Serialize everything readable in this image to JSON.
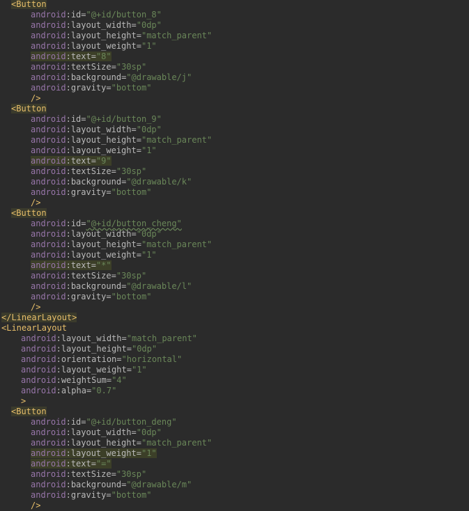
{
  "code_lines": [
    {
      "kind": "tag",
      "indent": 2,
      "text": "<Button",
      "highlight": true
    },
    {
      "kind": "attr",
      "indent": 6,
      "ns": "android",
      "attr": "id",
      "value": "\"@+id/button_8\""
    },
    {
      "kind": "attr",
      "indent": 6,
      "ns": "android",
      "attr": "layout_width",
      "value": "\"0dp\""
    },
    {
      "kind": "attr",
      "indent": 6,
      "ns": "android",
      "attr": "layout_height",
      "value": "\"match_parent\""
    },
    {
      "kind": "attr",
      "indent": 6,
      "ns": "android",
      "attr": "layout_weight",
      "value": "\"1\""
    },
    {
      "kind": "attr",
      "indent": 6,
      "ns": "android",
      "attr": "text",
      "value": "\"8\"",
      "highlight": true
    },
    {
      "kind": "attr",
      "indent": 6,
      "ns": "android",
      "attr": "textSize",
      "value": "\"30sp\""
    },
    {
      "kind": "attr",
      "indent": 6,
      "ns": "android",
      "attr": "background",
      "value": "\"@drawable/j\""
    },
    {
      "kind": "attr",
      "indent": 6,
      "ns": "android",
      "attr": "gravity",
      "value": "\"bottom\""
    },
    {
      "kind": "tag",
      "indent": 6,
      "text": "/>"
    },
    {
      "kind": "tag",
      "indent": 2,
      "text": "<Button",
      "highlight": true
    },
    {
      "kind": "attr",
      "indent": 6,
      "ns": "android",
      "attr": "id",
      "value": "\"@+id/button_9\""
    },
    {
      "kind": "attr",
      "indent": 6,
      "ns": "android",
      "attr": "layout_width",
      "value": "\"0dp\""
    },
    {
      "kind": "attr",
      "indent": 6,
      "ns": "android",
      "attr": "layout_height",
      "value": "\"match_parent\""
    },
    {
      "kind": "attr",
      "indent": 6,
      "ns": "android",
      "attr": "layout_weight",
      "value": "\"1\""
    },
    {
      "kind": "attr",
      "indent": 6,
      "ns": "android",
      "attr": "text",
      "value": "\"9\"",
      "highlight": true
    },
    {
      "kind": "attr",
      "indent": 6,
      "ns": "android",
      "attr": "textSize",
      "value": "\"30sp\""
    },
    {
      "kind": "attr",
      "indent": 6,
      "ns": "android",
      "attr": "background",
      "value": "\"@drawable/k\""
    },
    {
      "kind": "attr",
      "indent": 6,
      "ns": "android",
      "attr": "gravity",
      "value": "\"bottom\""
    },
    {
      "kind": "tag",
      "indent": 6,
      "text": "/>"
    },
    {
      "kind": "tag",
      "indent": 2,
      "text": "<Button",
      "highlight": true
    },
    {
      "kind": "attr",
      "indent": 6,
      "ns": "android",
      "attr": "id",
      "value": "\"@+id/button_cheng\"",
      "squiggle": true
    },
    {
      "kind": "attr",
      "indent": 6,
      "ns": "android",
      "attr": "layout_width",
      "value": "\"0dp\""
    },
    {
      "kind": "attr",
      "indent": 6,
      "ns": "android",
      "attr": "layout_height",
      "value": "\"match_parent\""
    },
    {
      "kind": "attr",
      "indent": 6,
      "ns": "android",
      "attr": "layout_weight",
      "value": "\"1\""
    },
    {
      "kind": "attr",
      "indent": 6,
      "ns": "android",
      "attr": "text",
      "value": "\"*\"",
      "highlight": true
    },
    {
      "kind": "attr",
      "indent": 6,
      "ns": "android",
      "attr": "textSize",
      "value": "\"30sp\""
    },
    {
      "kind": "attr",
      "indent": 6,
      "ns": "android",
      "attr": "background",
      "value": "\"@drawable/l\""
    },
    {
      "kind": "attr",
      "indent": 6,
      "ns": "android",
      "attr": "gravity",
      "value": "\"bottom\""
    },
    {
      "kind": "tag",
      "indent": 6,
      "text": "/>"
    },
    {
      "kind": "tag",
      "indent": 0,
      "text": "</LinearLayout>",
      "highlight": true
    },
    {
      "kind": "tag",
      "indent": 0,
      "text": "<LinearLayout"
    },
    {
      "kind": "attr",
      "indent": 4,
      "ns": "android",
      "attr": "layout_width",
      "value": "\"match_parent\""
    },
    {
      "kind": "attr",
      "indent": 4,
      "ns": "android",
      "attr": "layout_height",
      "value": "\"0dp\""
    },
    {
      "kind": "attr",
      "indent": 4,
      "ns": "android",
      "attr": "orientation",
      "value": "\"horizontal\""
    },
    {
      "kind": "attr",
      "indent": 4,
      "ns": "android",
      "attr": "layout_weight",
      "value": "\"1\""
    },
    {
      "kind": "attr",
      "indent": 4,
      "ns": "android",
      "attr": "weightSum",
      "value": "\"4\""
    },
    {
      "kind": "attr",
      "indent": 4,
      "ns": "android",
      "attr": "alpha",
      "value": "\"0.7\""
    },
    {
      "kind": "tag",
      "indent": 4,
      "text": ">"
    },
    {
      "kind": "tag",
      "indent": 2,
      "text": "<Button",
      "highlight": true
    },
    {
      "kind": "attr",
      "indent": 6,
      "ns": "android",
      "attr": "id",
      "value": "\"@+id/button_deng\""
    },
    {
      "kind": "attr",
      "indent": 6,
      "ns": "android",
      "attr": "layout_width",
      "value": "\"0dp\""
    },
    {
      "kind": "attr",
      "indent": 6,
      "ns": "android",
      "attr": "layout_height",
      "value": "\"match_parent\""
    },
    {
      "kind": "attr",
      "indent": 6,
      "ns": "android",
      "attr": "layout_weight",
      "value": "\"1\"",
      "highlight": true
    },
    {
      "kind": "attr",
      "indent": 6,
      "ns": "android",
      "attr": "text",
      "value": "\"=\"",
      "highlight": true
    },
    {
      "kind": "attr",
      "indent": 6,
      "ns": "android",
      "attr": "textSize",
      "value": "\"30sp\""
    },
    {
      "kind": "attr",
      "indent": 6,
      "ns": "android",
      "attr": "background",
      "value": "\"@drawable/m\""
    },
    {
      "kind": "attr",
      "indent": 6,
      "ns": "android",
      "attr": "gravity",
      "value": "\"bottom\""
    },
    {
      "kind": "tag",
      "indent": 6,
      "text": "/>"
    }
  ],
  "colors": {
    "background": "#2b2b2b",
    "tag": "#e8bf6a",
    "namespace": "#9876aa",
    "attribute": "#bababa",
    "value": "#6a8759",
    "highlight": "#3c3f28"
  }
}
